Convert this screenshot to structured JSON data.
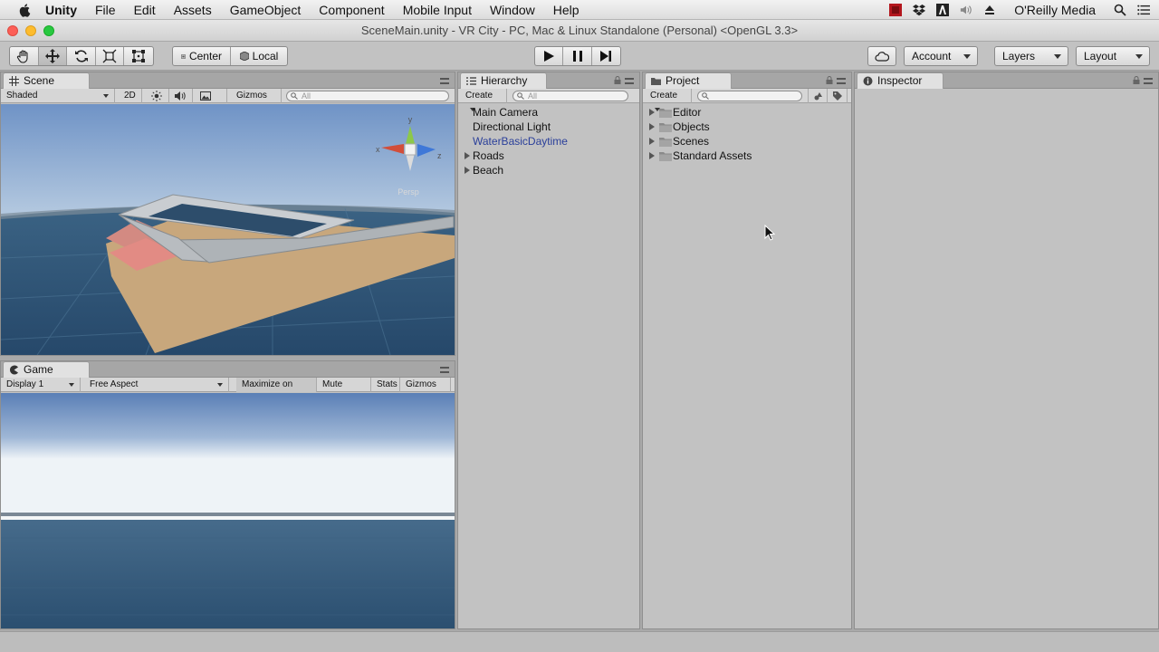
{
  "menubar": {
    "items": [
      "Unity",
      "File",
      "Edit",
      "Assets",
      "GameObject",
      "Component",
      "Mobile Input",
      "Window",
      "Help"
    ],
    "user": "O'Reilly Media"
  },
  "window": {
    "title": "SceneMain.unity - VR City - PC, Mac & Linux Standalone (Personal) <OpenGL 3.3>"
  },
  "toolbar": {
    "pivot_center": "Center",
    "pivot_local": "Local",
    "account": "Account",
    "layers": "Layers",
    "layout": "Layout"
  },
  "scene": {
    "tab": "Scene",
    "shading": "Shaded",
    "mode_2d": "2D",
    "gizmos": "Gizmos",
    "search_placeholder": "All",
    "axis_x": "x",
    "axis_y": "y",
    "axis_z": "z",
    "projection": "Persp"
  },
  "game": {
    "tab": "Game",
    "display": "Display 1",
    "aspect": "Free Aspect",
    "maximize": "Maximize on Play",
    "mute": "Mute audio",
    "stats": "Stats",
    "gizmos": "Gizmos"
  },
  "hierarchy": {
    "tab": "Hierarchy",
    "create": "Create",
    "search_placeholder": "All",
    "items": [
      {
        "label": "Main Camera"
      },
      {
        "label": "Directional Light"
      },
      {
        "label": "WaterBasicDaytime"
      },
      {
        "label": "Roads"
      },
      {
        "label": "Beach"
      }
    ]
  },
  "project": {
    "tab": "Project",
    "create": "Create",
    "folders": [
      "Editor",
      "Objects",
      "Scenes",
      "Standard Assets"
    ]
  },
  "inspector": {
    "tab": "Inspector"
  },
  "colors": {
    "panel_bg": "#c2c2c2",
    "selected_text": "#2a3f9a",
    "sky_top": "#5a7fb6",
    "water": "#2f5475"
  }
}
